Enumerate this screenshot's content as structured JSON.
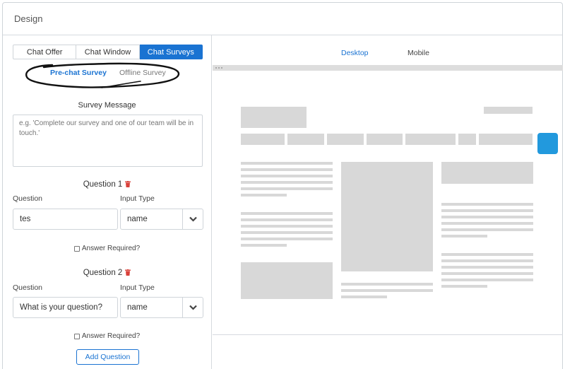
{
  "header": {
    "title": "Design"
  },
  "tabs": [
    {
      "label": "Chat Offer"
    },
    {
      "label": "Chat Window"
    },
    {
      "label": "Chat Surveys"
    }
  ],
  "subtabs": [
    {
      "label": "Pre-chat Survey"
    },
    {
      "label": "Offline Survey"
    }
  ],
  "survey": {
    "message_label": "Survey Message",
    "message_placeholder": "e.g. 'Complete our survey and one of our team will be in touch.'"
  },
  "questions": [
    {
      "title": "Question 1",
      "question_label": "Question",
      "input_type_label": "Input Type",
      "question_value": "tes",
      "input_type_value": "name",
      "answer_required_label": "Answer Required?"
    },
    {
      "title": "Question 2",
      "question_label": "Question",
      "input_type_label": "Input Type",
      "question_value": "What is your question?",
      "input_type_value": "name",
      "answer_required_label": "Answer Required?"
    }
  ],
  "add_question_label": "Add Question",
  "preview": {
    "tabs": [
      {
        "label": "Desktop"
      },
      {
        "label": "Mobile"
      }
    ]
  },
  "colors": {
    "accent": "#1a73d2",
    "chat_button": "#2299dd",
    "placeholder": "#d8d8d8",
    "trash": "#d9413a"
  }
}
